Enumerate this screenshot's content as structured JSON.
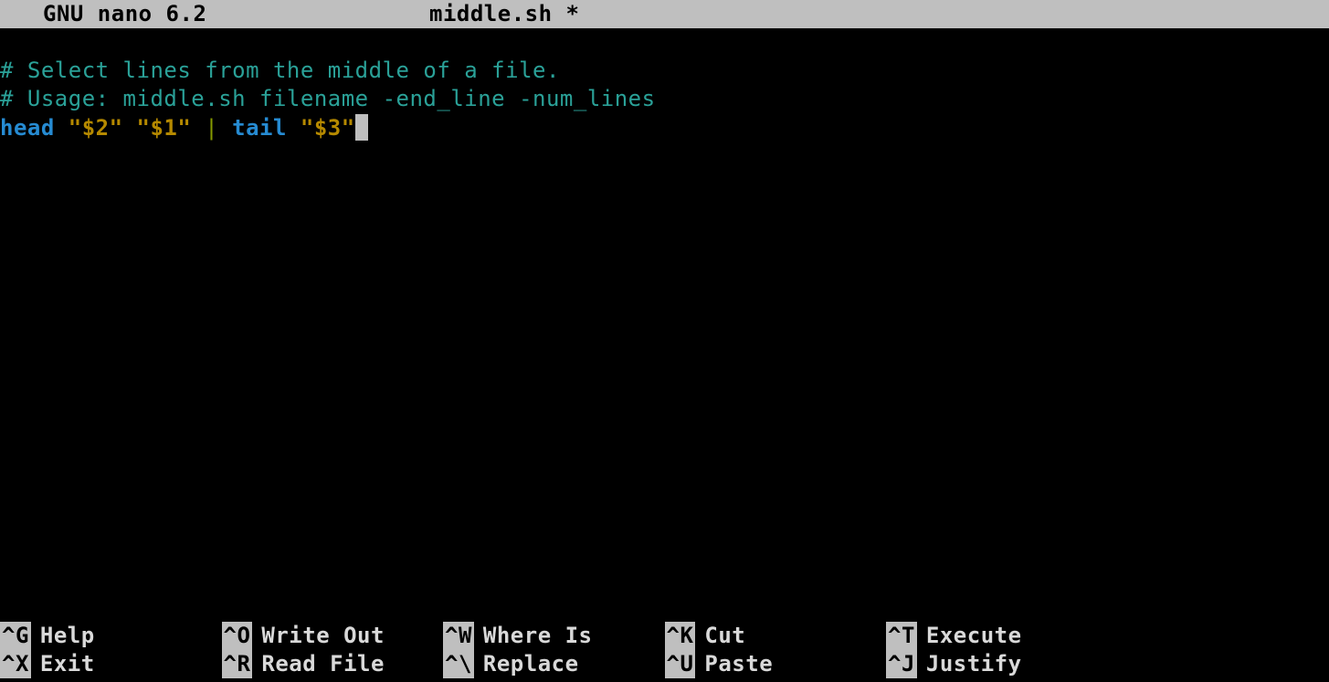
{
  "titlebar": {
    "app": "GNU nano 6.2",
    "filename": "middle.sh *"
  },
  "file_content": {
    "line1": "# Select lines from the middle of a file.",
    "line2": "# Usage: middle.sh filename -end_line -num_lines",
    "line3": {
      "cmd1": "head",
      "arg1": "\"$2\"",
      "arg2": "\"$1\"",
      "pipe": "|",
      "cmd2": "tail",
      "arg3": "\"$3\""
    }
  },
  "shortcuts": [
    {
      "key": "^G",
      "label": "Help"
    },
    {
      "key": "^O",
      "label": "Write Out"
    },
    {
      "key": "^W",
      "label": "Where Is"
    },
    {
      "key": "^K",
      "label": "Cut"
    },
    {
      "key": "^T",
      "label": "Execute"
    },
    {
      "key": "^X",
      "label": "Exit"
    },
    {
      "key": "^R",
      "label": "Read File"
    },
    {
      "key": "^\\",
      "label": "Replace"
    },
    {
      "key": "^U",
      "label": "Paste"
    },
    {
      "key": "^J",
      "label": "Justify"
    }
  ]
}
